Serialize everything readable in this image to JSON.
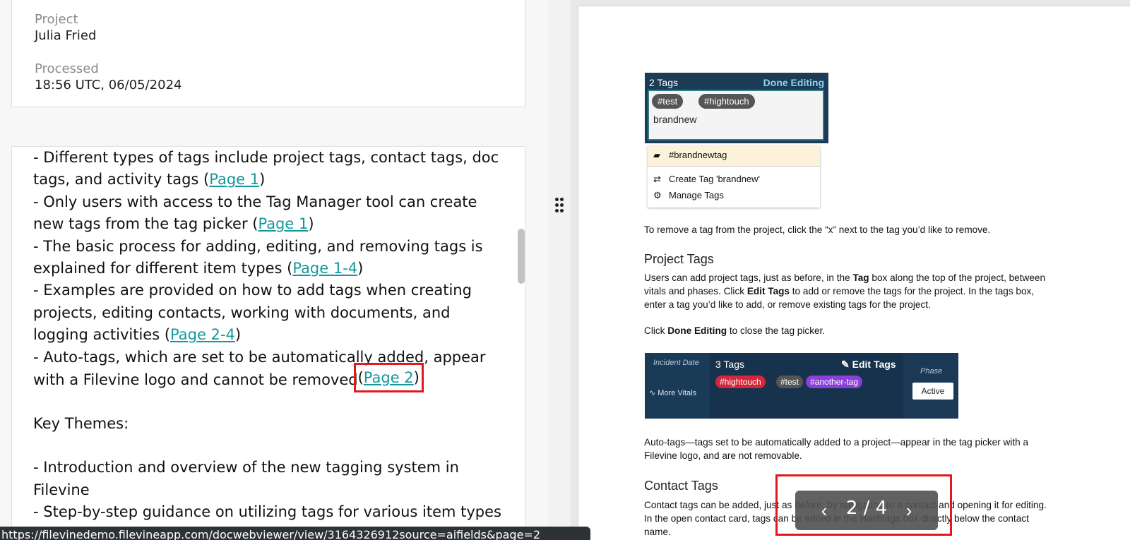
{
  "left": {
    "project_label": "Project",
    "project_value": "Julia Fried",
    "processed_label": "Processed",
    "processed_value": "18:56 UTC, 06/05/2024",
    "summary": {
      "l1": "- Different types of tags include project tags, contact tags, doc",
      "l2": "tags, and activity tags (",
      "l2_link": "Page 1",
      "l3": "- Only users with access to the Tag Manager tool can create",
      "l4": "new tags from the tag picker (",
      "l4_link": "Page 1",
      "l5": "- The basic process for adding, editing, and removing tags is",
      "l6": "explained for different item types (",
      "l6_link": "Page 1-4",
      "l7": "- Examples are provided on how to add tags when creating",
      "l8": "projects, editing contacts, working with documents, and",
      "l9": "logging activities (",
      "l9_link": "Page 2-4",
      "l10": "- Auto-tags, which are set to be automatically added, appear",
      "l11": "with a Filevine logo and cannot be removed",
      "l11_link": "Page 2",
      "key_themes": "Key Themes:",
      "k1": "- Introduction and overview of the new tagging system in",
      "k2": "Filevine",
      "k3": "- Step-by-step guidance on utilizing tags for various item types"
    },
    "paren_open": "(",
    "paren_close": ")",
    "status_url": "https://filevinedemo.filevineapp.com/docwebviewer/view/3164326912source=aifields&page=2"
  },
  "doc": {
    "shot1": {
      "title": "2 Tags",
      "done": "Done Editing",
      "chip1": "#test",
      "chip2": "#hightouch",
      "typed": "brandnew",
      "opt1": "#brandnewtag",
      "opt2": "Create Tag 'brandnew'",
      "opt3": "Manage Tags"
    },
    "p1": "To remove a tag from the project, click the “x” next to the tag you’d like to remove.",
    "h_project": "Project Tags",
    "p2a": "Users can add project tags, just as before, in the ",
    "p2_tag": "Tag",
    "p2b": " box along the top of the project, between",
    "p2c": "vitals and phases. Click ",
    "p2_edit": "Edit Tags",
    "p2d": " to add or remove the tags for the project. In the tags box,",
    "p2e": "enter a tag you’d like to add, or remove existing tags for the project.",
    "p3a": "Click ",
    "p3_done": "Done Editing",
    "p3b": " to close the tag picker.",
    "shot2": {
      "incident": "Incident Date",
      "vitals": "More Vitals",
      "count": "3 Tags",
      "edit": "Edit Tags",
      "tag1": "#hightouch",
      "tag2": "#test",
      "tag3": "#another-tag",
      "phase": "Phase",
      "active": "Active"
    },
    "p4a": "Auto-tags—tags set to be automatically added to a project—appear in the tag picker with a",
    "p4b": "Filevine logo, and are not removable.",
    "h_contact": "Contact Tags",
    "p5a": "Contact tags can be added, just as before, by navigating to a contact and opening it for editing.",
    "p5b": "In the open contact card, tags can be edited in the Hashtags box directly below the contact",
    "p5c": "name."
  },
  "pager": {
    "text": "2 / 4",
    "prev": "‹",
    "next": "›"
  }
}
